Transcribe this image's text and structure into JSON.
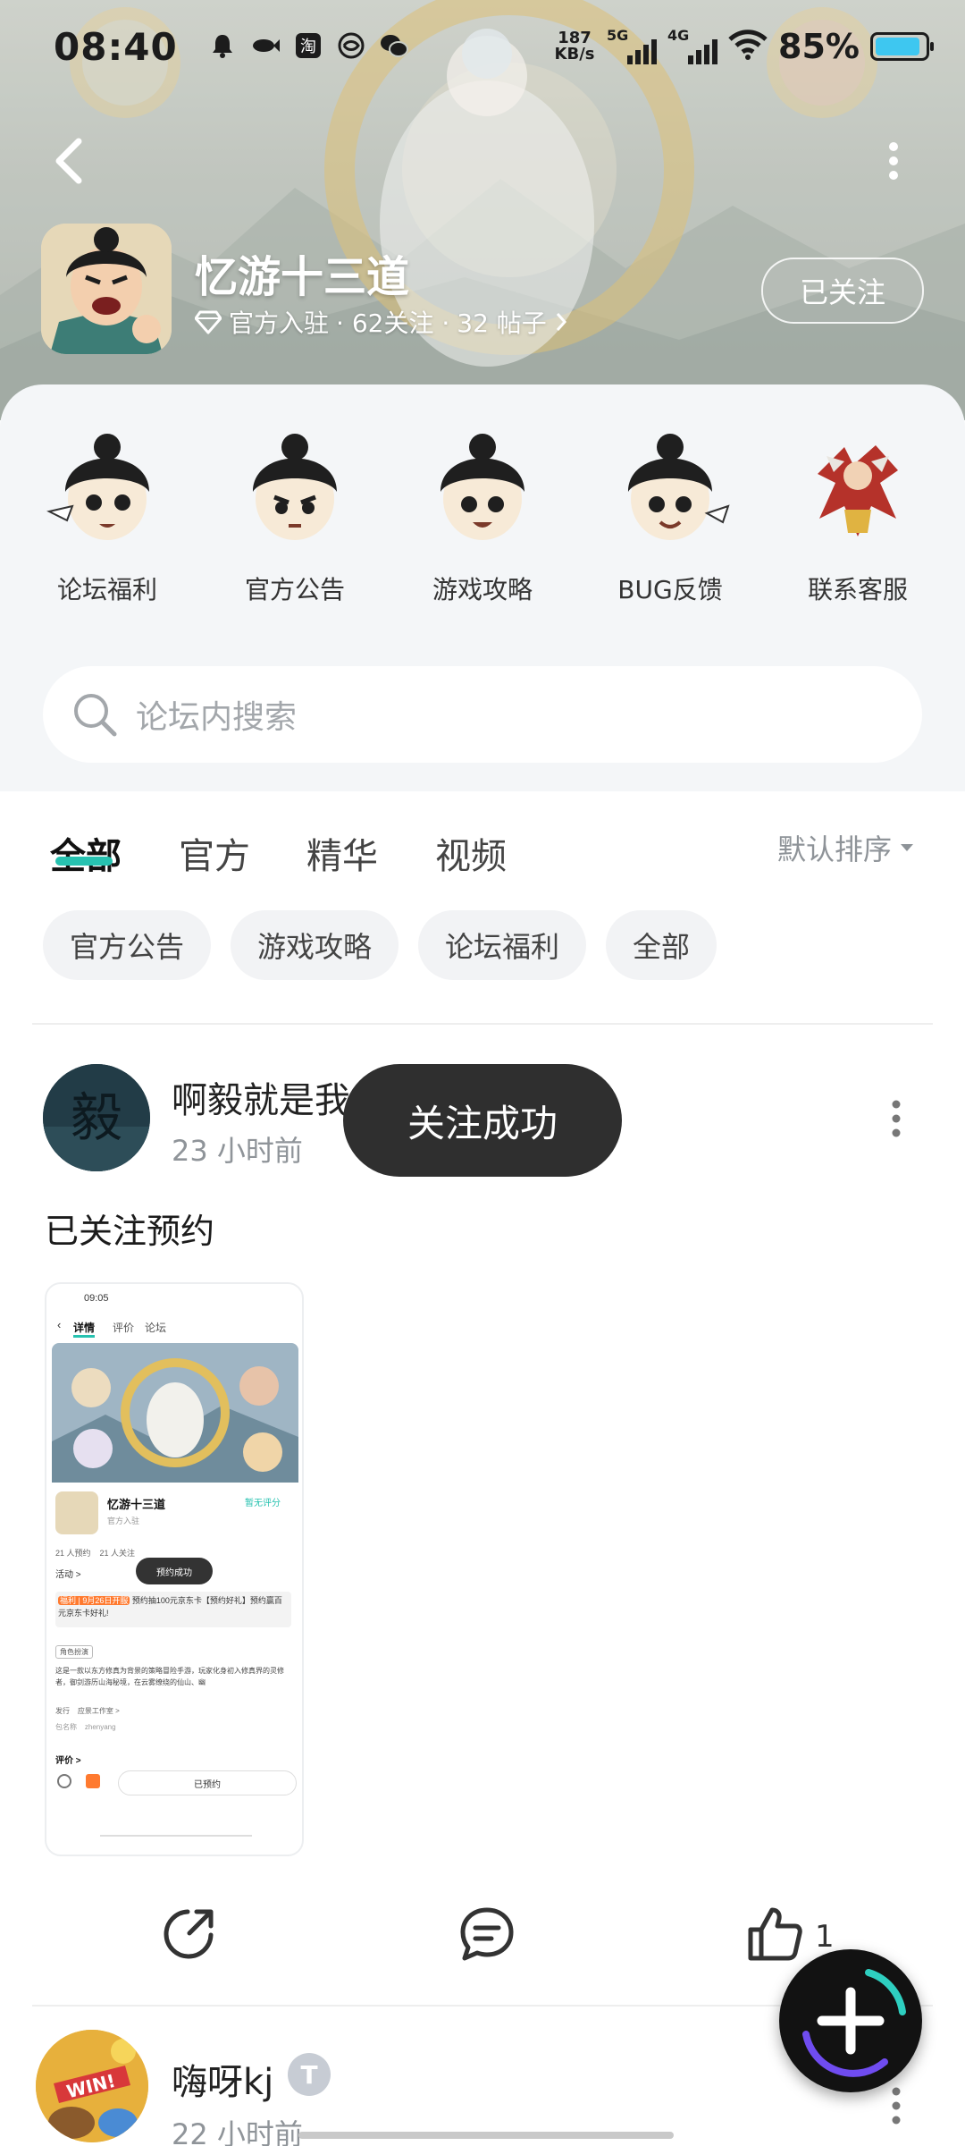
{
  "status_bar": {
    "time": "08:40",
    "net_speed_value": "187",
    "net_speed_unit": "KB/s",
    "sim1_label": "5G",
    "sim2_label": "4G",
    "battery_percent": "85%",
    "battery_level": 0.85,
    "left_icons": [
      "bell-icon",
      "fish-icon",
      "taobao-icon",
      "mobile-icon",
      "wechat-icon"
    ]
  },
  "header": {
    "forum_name": "忆游十三道",
    "meta_official": "官方入驻",
    "meta_follow": "· 62关注 ·",
    "meta_posts": "32 帖子",
    "follow_button": "已关注"
  },
  "shortcuts": [
    {
      "label": "论坛福利"
    },
    {
      "label": "官方公告"
    },
    {
      "label": "游戏攻略"
    },
    {
      "label": "BUG反馈"
    },
    {
      "label": "联系客服"
    }
  ],
  "search": {
    "placeholder": "论坛内搜索"
  },
  "tabs": [
    {
      "label": "全部"
    },
    {
      "label": "官方"
    },
    {
      "label": "精华"
    },
    {
      "label": "视频"
    }
  ],
  "sort_label": "默认排序",
  "chips": [
    {
      "label": "官方公告"
    },
    {
      "label": "游戏攻略"
    },
    {
      "label": "论坛福利"
    },
    {
      "label": "全部"
    }
  ],
  "post1": {
    "author": "啊毅就是我",
    "time": "23 小时前",
    "text": "已关注预约",
    "like_count": "1",
    "screenshot": {
      "time": "09:05",
      "tab_detail": "详情",
      "tab_review": "评价",
      "tab_forum": "论坛",
      "game_name": "忆游十三道",
      "no_rating": "暂无评分",
      "official": "官方入驻",
      "stats": "21 人预约    21 人关注",
      "activity": "活动 >",
      "toast": "预约成功",
      "promo_tag": "福利 | 9月26日开服",
      "promo_text": "预约抽100元京东卡【预约好礼】预约赢百元京东卡好礼!",
      "tag": "角色扮演",
      "desc": "这是一款以东方修真为背景的策略冒险手游，玩家化身初入修真界的灵修者，御剑游历山海秘境，在云雾缭绕的仙山、幽",
      "publisher": "发行    应景工作室 >",
      "package": "包名称    zhenyang",
      "review": "评价 >",
      "reserved": "已预约"
    }
  },
  "post2": {
    "author": "嗨呀kj",
    "badge": "T",
    "time": "22 小时前"
  },
  "toast": "关注成功"
}
